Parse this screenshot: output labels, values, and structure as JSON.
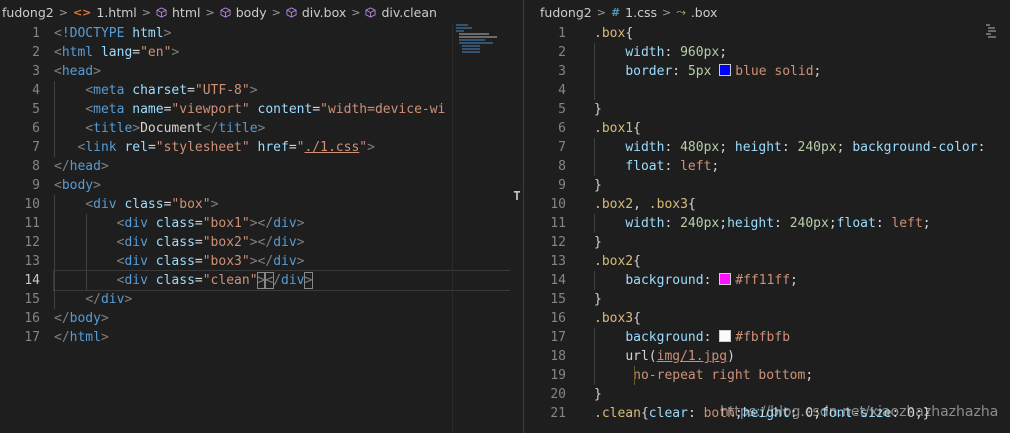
{
  "left_editor": {
    "breadcrumb": [
      "fudong2",
      "1.html",
      "html",
      "body",
      "div.box",
      "div.clean"
    ],
    "line_numbers": [
      "1",
      "2",
      "3",
      "4",
      "5",
      "6",
      "7",
      "8",
      "9",
      "10",
      "11",
      "12",
      "13",
      "14",
      "15",
      "16",
      "17"
    ],
    "active_line": "14"
  },
  "right_editor": {
    "breadcrumb": [
      "fudong2",
      "1.css",
      ".box"
    ],
    "line_numbers": [
      "1",
      "2",
      "3",
      "4",
      "5",
      "6",
      "7",
      "8",
      "9",
      "10",
      "11",
      "12",
      "13",
      "14",
      "15",
      "16",
      "17",
      "18",
      "19",
      "20",
      "21"
    ]
  },
  "colors": {
    "blue_swatch": "#0000ff",
    "pink_swatch": "#ff11ff",
    "white_swatch": "#fbfbfb",
    "editor_bg": "#1e1e1e"
  },
  "icons": {
    "html_file": "html-file-icon",
    "element": "cube-icon",
    "css_file": "hash-icon",
    "selector": "css-selector-icon",
    "separator": "chevron-right-icon",
    "split": "split-handle-icon"
  },
  "watermark": "https://blog.csdn.net/xiaozhazhazhazha"
}
